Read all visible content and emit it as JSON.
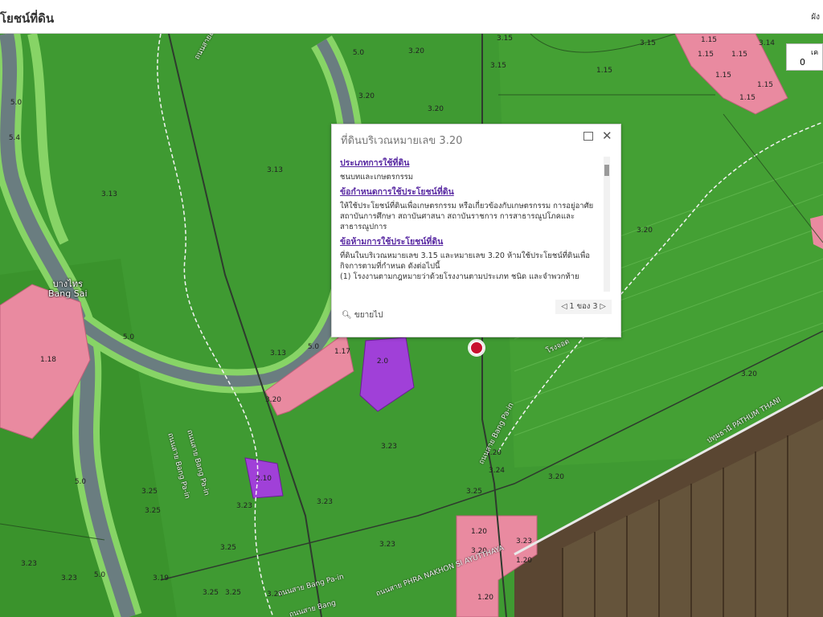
{
  "header": {
    "title": "โยชน์ที่ดิน",
    "right_text": "ผัง"
  },
  "scale_box": {
    "top_label": "เค",
    "value": "0"
  },
  "popup": {
    "title": "ที่ดินบริเวณหมายเลข 3.20",
    "section1_heading": "ประเภทการใช้ที่ดิน",
    "section1_text": "ชนบทและเกษตรกรรม",
    "section2_heading": "ข้อกำหนดการใช้ประโยชน์ที่ดิน",
    "section2_text": "ให้ใช้ประโยชน์ที่ดินเพื่อเกษตรกรรม หรือเกี่ยวข้องกับเกษตรกรรม การอยู่อาศัย สถาบันการศึกษา สถาบันศาสนา สถาบันราชการ การสาธารณูปโภคและสาธารณูปการ",
    "section3_heading": "ข้อห้ามการใช้ประโยชน์ที่ดิน",
    "section3_text": "ที่ดินในบริเวณหมายเลข 3.15 และหมายเลข 3.20 ห้ามใช้ประโยชน์ที่ดินเพื่อกิจการตามที่กำหนด ดังต่อไปนี้",
    "section3_item": "(1) โรงงานตามกฎหมายว่าด้วยโรงงานตามประเภท ชนิด และจำพวกท้าย",
    "zoom_label": "ขยายไป",
    "pager_text": "1 ของ 3"
  },
  "places": {
    "bang_sai_thai": "บางไทร",
    "bang_sai_en": "Bang Sai"
  },
  "road_labels": {
    "r1": "ถนนสายอยุธยา-บางปะหัน",
    "r2": "ถนนสาย Bang Pa-in",
    "r3": "ถนนสาย Bang Pa-in",
    "r4": "ถนนสาย Bang Pa-in",
    "r5": "ปทุมธานี PATHUM THANI",
    "r6": "ถนนสาย Bang Pa-in",
    "r7": "ถนนสาย PHRA NAKHON SI AYUTTHAYA",
    "r8": "ถนนสาย Bang",
    "r9": "โรงจอด"
  },
  "zones": [
    "3.15",
    "3.15",
    "3.15",
    "3.14",
    "1.15",
    "1.15",
    "1.15",
    "1.15",
    "1.15",
    "1.15",
    "1.15",
    "5.0",
    "3.20",
    "3.20",
    "3.20",
    "5.0",
    "3.13",
    "3.13",
    "3.20",
    "1.18",
    "5.0",
    "5.0",
    "3.13",
    "1.17",
    "3.20",
    "2.0",
    "3.23",
    "3.20",
    "3.20",
    "3.20",
    "3.24",
    "2.10",
    "3.25",
    "3.23",
    "3.23",
    "3.25",
    "3.25",
    "3.25",
    "3.20",
    "3.23",
    "3.23",
    "1.20",
    "1.20",
    "1.20",
    "5.0",
    "3.19",
    "3.23",
    "3.25",
    "3.25",
    "3.25",
    "5.4",
    "5.0",
    "3.23"
  ]
}
